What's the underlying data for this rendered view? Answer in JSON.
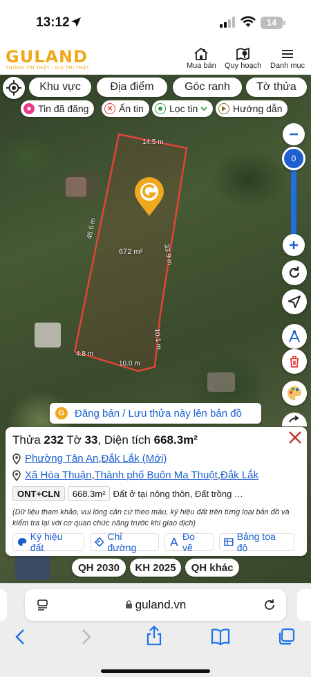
{
  "status": {
    "time": "13:12",
    "battery": "14"
  },
  "header": {
    "brand": "GULAND",
    "slogan": "THÔNG TIN THẬT - GIÁ TRỊ THẬT",
    "nav": [
      {
        "label": "Mua bán",
        "icon": "house-icon"
      },
      {
        "label": "Quy hoạch",
        "icon": "map-pin-icon"
      },
      {
        "label": "Danh mục",
        "icon": "menu-icon"
      }
    ]
  },
  "map_tabs": [
    "Khu vực",
    "Địa điểm",
    "Góc ranh",
    "Tờ thửa"
  ],
  "chips": [
    {
      "label": "Tin đã đăng",
      "color": "#e83e8c"
    },
    {
      "label": "Ẩn tin",
      "color": "#e53935"
    },
    {
      "label": "Lọc tin",
      "color": "#2e9e44"
    },
    {
      "label": "Hướng dẫn",
      "color": "#8a6d1f"
    }
  ],
  "zoom": {
    "value": "0"
  },
  "parcel": {
    "edges": {
      "top": "14.5 m",
      "left": "45.6 m",
      "right": "33.9 m",
      "step": "10.1 m",
      "bottom_left": "4.8 m",
      "bottom": "10.0 m"
    },
    "area_label": "672 m²"
  },
  "cta": "Đăng bán / Lưu thửa này lên bản đồ",
  "info": {
    "thua_prefix": "Thửa ",
    "thua": "232",
    "to_prefix": " Tờ ",
    "to": "33",
    "dt_prefix": ", Diện tích ",
    "dt": "668.3m²",
    "loc1": {
      "a": "Phường Tân An",
      "sep": ", ",
      "b": "Đắk Lắk (Mới)"
    },
    "loc2": {
      "a": "Xã Hòa Thuận",
      "sep1": ", ",
      "b": "Thành phố Buôn Ma Thuột",
      "sep2": ", ",
      "c": "Đắk Lắk"
    },
    "tag": "ONT+CLN",
    "tag_area": "668.3m²",
    "tag_desc": "Đất ở tại nông thôn, Đất trồng cây lâu năm",
    "note": "(Dữ liệu tham khảo, vui lòng căn cứ theo màu, ký hiệu đất trên từng loại bản đồ và kiểm tra lại với cơ quan chức năng trước khi giao dịch)",
    "buttons": [
      "Ký hiệu đất",
      "Chỉ đường",
      "Đo vẽ",
      "Bảng tọa độ"
    ]
  },
  "qh": [
    "QH 2030",
    "KH 2025",
    "QH khác"
  ],
  "safari": {
    "url": "guland.vn"
  }
}
